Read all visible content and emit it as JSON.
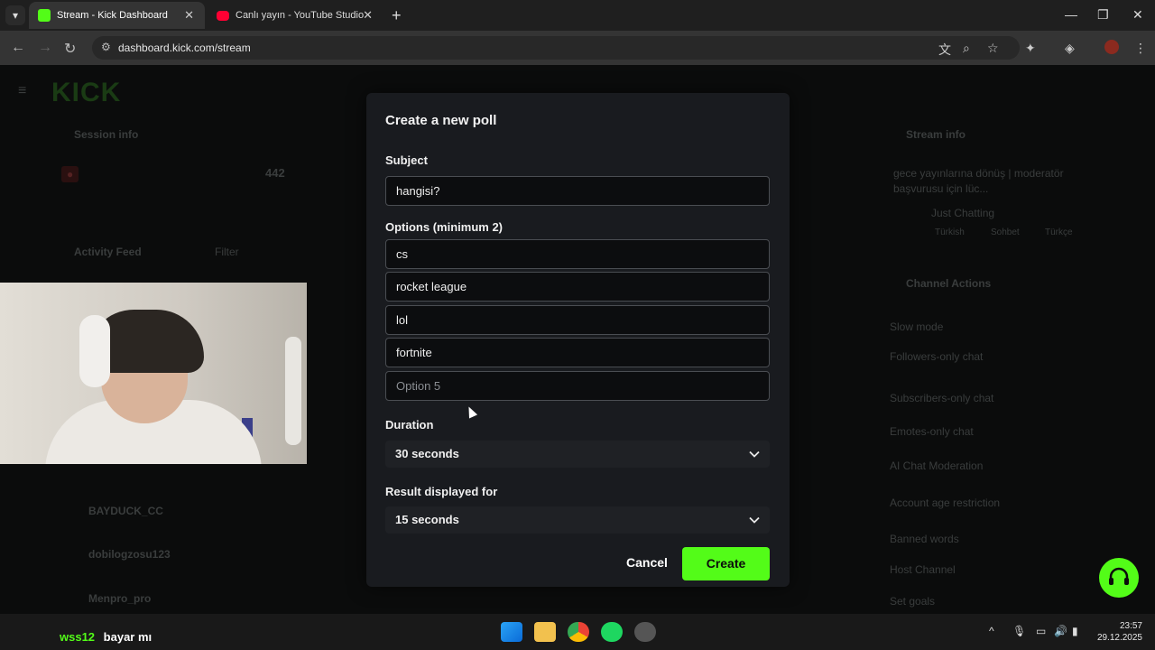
{
  "browser": {
    "tabs": [
      {
        "title": "Stream - Kick Dashboard",
        "active": true
      },
      {
        "title": "Canlı yayın - YouTube Studio",
        "active": false
      }
    ],
    "url": "dashboard.kick.com/stream"
  },
  "background": {
    "logo": "KICK",
    "session_info": "Session info",
    "activity_feed": "Activity Feed",
    "filter": "Filter",
    "stream_info": "Stream info",
    "stream_title": "gece yayınlarına dönüş | moderatör başvurusu için lüc...",
    "category": "Just Chatting",
    "tags": [
      "Türkish",
      "Sohbet",
      "Türkçe"
    ],
    "channel_actions": "Channel Actions",
    "actions": [
      "Slow mode",
      "Followers-only chat",
      "Subscribers-only chat",
      "Emotes-only chat",
      "AI Chat Moderation",
      "Account age restriction",
      "Banned words",
      "Host Channel",
      "Set goals"
    ],
    "followers_value": "442",
    "feed_users": [
      "BAYDUCK_CC",
      "dobilogzosu123",
      "Menpro_pro"
    ]
  },
  "modal": {
    "title": "Create a new poll",
    "subject_label": "Subject",
    "subject_value": "hangisi?",
    "options_label": "Options (minimum 2)",
    "options": [
      "cs",
      "rocket league",
      "lol",
      "fortnite"
    ],
    "option_placeholder": "Option 5",
    "duration_label": "Duration",
    "duration_value": "30 seconds",
    "result_label": "Result displayed for",
    "result_value": "15 seconds",
    "cancel_label": "Cancel",
    "create_label": "Create"
  },
  "chat_overlay": {
    "user": "wss12",
    "message": "bayar mı"
  },
  "taskbar": {
    "time": "23:57",
    "date": "29.12.2025"
  },
  "colors": {
    "accent": "#53fc18",
    "modal_bg": "#191b1f"
  }
}
